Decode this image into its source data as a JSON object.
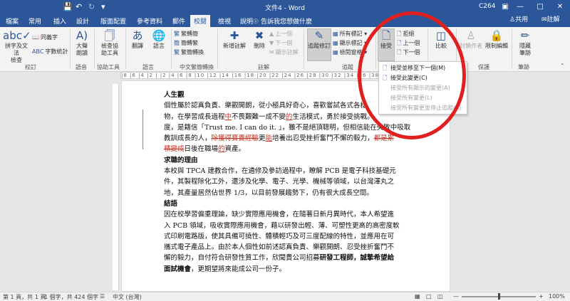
{
  "titlebar": {
    "title": "文件4 - Word",
    "user": "C264",
    "save_icon": "save-icon",
    "undo_icon": "undo-icon",
    "redo_icon": "redo-icon",
    "customize_icon": "customize-icon"
  },
  "tabs": [
    "檔案",
    "常用",
    "插入",
    "設計",
    "版面配置",
    "參考資料",
    "郵件",
    "校閱",
    "檢視",
    "說明"
  ],
  "active_tab": "校閱",
  "tell_me": "告訴我您想做什麼",
  "share": "共用",
  "comments_label": "註解",
  "ribbon": {
    "proofing": {
      "spell": "拼字及文法\n檢查",
      "thesaurus": "同義字",
      "word_count": "字數統計",
      "label": "校訂"
    },
    "speech": {
      "read_aloud": "大聲\n朗讀",
      "label": "語音"
    },
    "accessibility": {
      "check": "檢查協\n助工具",
      "label": "協助工具"
    },
    "language": {
      "translate": "翻譯",
      "language": "語言",
      "label": "語言"
    },
    "chinese": {
      "to_trad": "繁轉簡",
      "to_simp": "簡轉繁",
      "convert": "繁簡轉換",
      "label": "中文繁簡轉換"
    },
    "comments": {
      "new": "新增註解",
      "delete": "刪除",
      "prev": "上一個",
      "next": "下一個",
      "show": "顯示註解",
      "label": "註解"
    },
    "tracking": {
      "track": "追蹤修訂",
      "markup": "所有標記",
      "show_markup": "顯示標記",
      "pane": "檢閱窗格",
      "label": "追蹤"
    },
    "changes": {
      "accept": "接受",
      "reject": "拒絕",
      "prev": "上一個",
      "next": "下一個",
      "label": "變更"
    },
    "compare": {
      "compare": "比較",
      "label": "比較"
    },
    "protect": {
      "block": "封鎖作者",
      "restrict": "限制編輯",
      "label": "保護"
    },
    "ink": {
      "hide": "隱藏\n筆跡",
      "label": "筆跡"
    }
  },
  "accept_menu": [
    {
      "label": "接受並移至下一個(M)",
      "enabled": true
    },
    {
      "label": "接受此變更(C)",
      "enabled": true
    },
    {
      "label": "接受所有顯示的變更(A)",
      "enabled": false
    },
    {
      "label": "接受所有變更(L)",
      "enabled": false
    },
    {
      "label": "接受所有變更並停止追蹤(S)",
      "enabled": false
    }
  ],
  "ruler": "|8 |6 |4 |2 | |2 |4 |6 |8 |10 |12 |14 |16 |18 |20 |22 |24 |26 |28 |30 |32 |34 |36 |38 |40 |42 |44 |46 |",
  "document": {
    "h1": "人生觀",
    "p1_l1a": "個性屬於認真負責、樂觀開朗，從小極具好奇心，喜歡嘗試各式各樣",
    "p1_l2a": "物，在學習成長過程",
    "p1_l2_ins1": "中",
    "p1_l2b": "不畏艱難一成不變",
    "p1_l2_ins2": "的",
    "p1_l2c": "生活模式，勇於接受挑戰。",
    "p1_l3": "度，是籍信「Trust me. I can do it. 」，雖不是絕頂聰明，但相信能在失敗中吸取",
    "p1_l4a": "教訓成長的人，",
    "p1_l4_del": "除獲得寶貴經驗",
    "p1_l4b": "更",
    "p1_l4_ins": "能",
    "p1_l4c": "培養出忍受挫折奮鬥不懈的毅力，",
    "p1_l4_del2": "都是累",
    "p1_l5_del": "積變成",
    "p1_l5a": "日後在職場",
    "p1_l5_ins": "的",
    "p1_l5b": "資產。",
    "h2": "求職的理由",
    "p2_l1": "本校與 TPCA 建教合作，在遴修及參訪過程中，瞭解 PCB 是電子科技基礎元",
    "p2_l2": "件，其製程除化工外，還涉及化學、電子、光學、機械等領域，以台灣澤丸之",
    "p2_l3": "地，其產量居然佔世界 1/3，以目前發展趨勢下，仍有很大成長空間。",
    "h3": "結語",
    "p3_l1": "因在校學習偏重理論，缺少實際應用機會，在隨著日新月異時代，本人希望進",
    "p3_l2": "入 PCB 領域，吸收實際應用機會，藉以研發出輕、薄、可塑性更高的高密度軟",
    "p3_l3": "式印刷電路版，使其具備可撓性、體積輕巧及可三度配線的特性，並應用在可",
    "p3_l4": "攜式電子產品上。由於本人個性如前述認真負責、樂觀開朗、忍受挫折奮鬥不",
    "p3_l5a": "懈的毅力，自付符合研發性質工作，欣聞貴公司招募",
    "p3_l5b": "研發工程師，誠摯希望給",
    "p3_l6a": "面試機會",
    "p3_l6b": "，更期望將來能成公司一份子。"
  },
  "status": {
    "page": "第 1 頁，共 1 頁",
    "words": "1 個字，共 424 個字",
    "language": "中文 (台灣)",
    "zoom": "100%",
    "zoom_level": 1.0
  }
}
